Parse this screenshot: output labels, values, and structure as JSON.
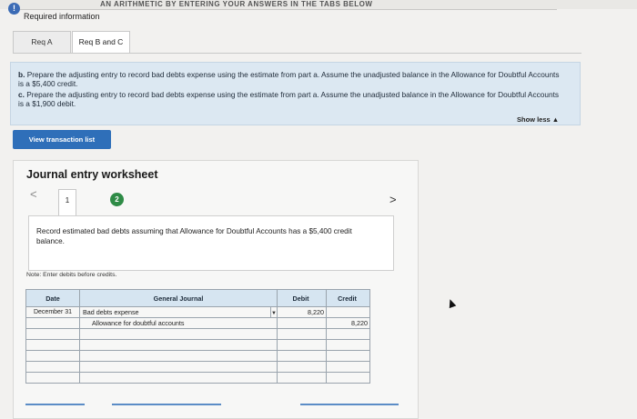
{
  "header": {
    "top_text": "AN ARITHMETIC BY ENTERING YOUR ANSWERS IN THE TABS BELOW",
    "alert_icon": "!",
    "required_information": "Required information"
  },
  "tabs": [
    {
      "label": "Req A"
    },
    {
      "label": "Req B and C"
    }
  ],
  "instructions": {
    "b_prefix": "b.",
    "b_text": "Prepare the adjusting entry to record bad debts expense using the estimate from part a. Assume the unadjusted balance in the Allowance for Doubtful Accounts is a $5,400 credit.",
    "c_prefix": "c.",
    "c_text": "Prepare the adjusting entry to record bad debts expense using the estimate from part a. Assume the unadjusted balance in the Allowance for Doubtful Accounts is a $1,900 debit.",
    "show_less": "Show less ▲"
  },
  "view_transaction_list": "View transaction list",
  "worksheet": {
    "title": "Journal entry worksheet",
    "prev": "<",
    "next": ">",
    "step1": "1",
    "step2": "2",
    "prompt": "Record estimated bad debts assuming that Allowance for Doubtful Accounts has a $5,400 credit balance.",
    "note": "Note: Enter debits before credits."
  },
  "journal": {
    "headers": {
      "date": "Date",
      "account": "General Journal",
      "debit": "Debit",
      "credit": "Credit"
    },
    "rows": [
      {
        "date": "December 31",
        "account": "Bad debts expense",
        "debit": "8,220",
        "credit": ""
      },
      {
        "date": "",
        "account": "Allowance for doubtful accounts",
        "debit": "",
        "credit": "8,220"
      }
    ]
  },
  "colors": {
    "accent_blue": "#2f6fb9",
    "panel_blue": "#dce8f2",
    "step_green": "#2e8b46"
  }
}
